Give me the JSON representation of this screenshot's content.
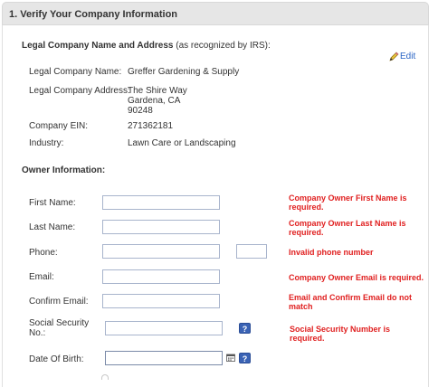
{
  "panel": {
    "title": "1. Verify Your Company Information"
  },
  "legal": {
    "heading": "Legal Company Name and Address",
    "heading_note": "(as recognized by IRS):",
    "edit_label": "Edit",
    "company_name_label": "Legal Company Name:",
    "company_name_value": "Greffer Gardening & Supply",
    "address_label": "Legal Company Address:",
    "address_line1": "The Shire Way",
    "address_line2": "Gardena, CA",
    "address_line3": "90248",
    "ein_label": "Company EIN:",
    "ein_value": "271362181",
    "industry_label": "Industry:",
    "industry_value": "Lawn Care or Landscaping"
  },
  "owner": {
    "heading": "Owner Information:",
    "first_name": {
      "label": "First Name:",
      "value": "",
      "error": "Company Owner First Name is required."
    },
    "last_name": {
      "label": "Last Name:",
      "value": "",
      "error": "Company Owner Last Name is required."
    },
    "phone": {
      "label": "Phone:",
      "value": "",
      "ext_value": "",
      "error": "Invalid phone number"
    },
    "email": {
      "label": "Email:",
      "value": "",
      "error": "Company Owner Email is required."
    },
    "confirm_email": {
      "label": "Confirm Email:",
      "value": "",
      "error": "Email and Confirm Email do not match"
    },
    "ssn": {
      "label_line1": "Social Security",
      "label_line2": "No.:",
      "value": "",
      "error": "Social Security Number is required."
    },
    "dob": {
      "label": "Date Of Birth:",
      "value": ""
    },
    "help_symbol": "?"
  },
  "colors": {
    "error": "#e02020",
    "link": "#2a64c5",
    "help_bg": "#3b63b5",
    "header_bg": "#e6e6e6"
  },
  "icons": {
    "edit": "pencil-icon",
    "calendar": "calendar-icon",
    "help": "help-icon"
  }
}
